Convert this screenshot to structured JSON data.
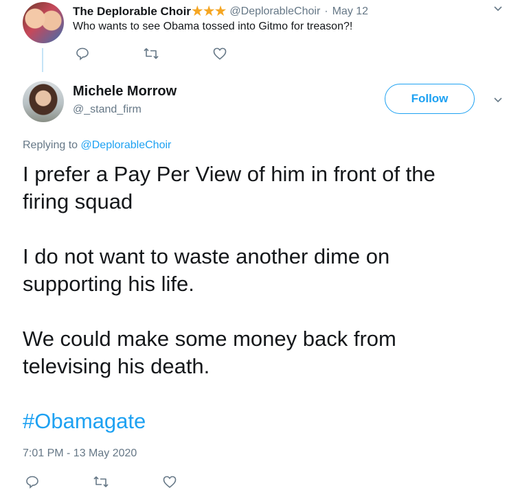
{
  "parent_tweet": {
    "display_name": "The Deplorable Choir",
    "stars": "★★★",
    "handle": "@DeplorableChoir",
    "separator": "·",
    "date": "May 12",
    "text": "Who wants to see Obama tossed into Gitmo for treason?!"
  },
  "main_tweet": {
    "display_name": "Michele Morrow",
    "handle": "@_stand_firm",
    "follow_label": "Follow",
    "replying_prefix": "Replying to",
    "replying_handle": "@DeplorableChoir",
    "paragraphs": [
      [
        "I prefer a Pay Per View of him in front of the",
        "firing squad"
      ],
      [
        "I do not want to waste another dime on",
        "supporting his life."
      ],
      [
        "We could make some money back from",
        "televising his death."
      ]
    ],
    "hashtag": "#Obamagate",
    "timestamp": "7:01 PM - 13 May 2020"
  },
  "colors": {
    "accent": "#1da1f2",
    "secondary_text": "#657786",
    "star": "#f5a623"
  },
  "icons": [
    "reply-icon",
    "retweet-icon",
    "like-icon",
    "chevron-down-icon"
  ]
}
